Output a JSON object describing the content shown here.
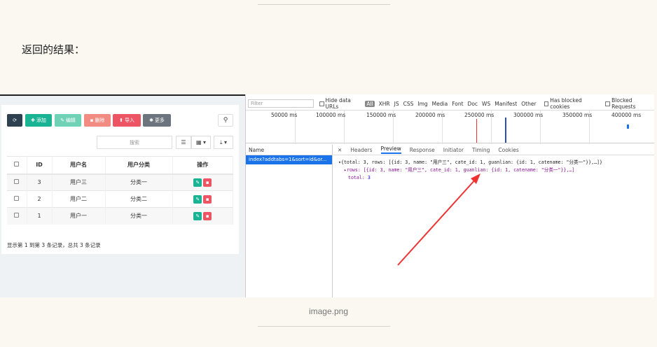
{
  "heading": "返回的结果：",
  "caption": "image.png",
  "admin": {
    "buttons": [
      {
        "name": "refresh",
        "label": "",
        "color": "#2f4050"
      },
      {
        "name": "add",
        "label": "添加",
        "color": "#1ab394"
      },
      {
        "name": "edit",
        "label": "编辑",
        "color": "#6fd1b6"
      },
      {
        "name": "delete",
        "label": "删除",
        "color": "#f28b82"
      },
      {
        "name": "import",
        "label": "导入",
        "color": "#ed5565"
      },
      {
        "name": "more",
        "label": "更多",
        "color": "#6c757d"
      }
    ],
    "search_placeholder": "搜索",
    "columns": [
      "ID",
      "用户名",
      "用户分类",
      "操作"
    ],
    "rows": [
      {
        "id": "3",
        "name": "用户三",
        "cate": "分类一"
      },
      {
        "id": "2",
        "name": "用户二",
        "cate": "分类二"
      },
      {
        "id": "1",
        "name": "用户一",
        "cate": "分类一"
      }
    ],
    "footer": "显示第 1 到第 3 条记录，总共 3 条记录"
  },
  "devtools": {
    "filter_placeholder": "Filter",
    "hide_data_urls": "Hide data URLs",
    "types": [
      "All",
      "XHR",
      "JS",
      "CSS",
      "Img",
      "Media",
      "Font",
      "Doc",
      "WS",
      "Manifest",
      "Other"
    ],
    "has_blocked_cookies": "Has blocked cookies",
    "blocked_requests": "Blocked Requests",
    "ticks": [
      "50000 ms",
      "100000 ms",
      "150000 ms",
      "200000 ms",
      "250000 ms",
      "300000 ms",
      "350000 ms",
      "400000 ms"
    ],
    "name_header": "Name",
    "request_name": "index?addtabs=1&sort=id&or...",
    "tabs": [
      "Headers",
      "Preview",
      "Response",
      "Initiator",
      "Timing",
      "Cookies"
    ],
    "active_tab": "Preview",
    "preview_line1": "▾{total: 3, rows: [{id: 3, name: \"用户三\", cate_id: 1, guanlian: {id: 1, catename: \"分类一\"}},…]}",
    "preview_line2": "▸rows: [{id: 3, name: \"用户三\", cate_id: 1, guanlian: {id: 1, catename: \"分类一\"}},…]",
    "preview_line3_key": "total:",
    "preview_line3_val": "3"
  },
  "colors": {
    "arrow": "#ee3333",
    "selected": "#1a73e8"
  }
}
